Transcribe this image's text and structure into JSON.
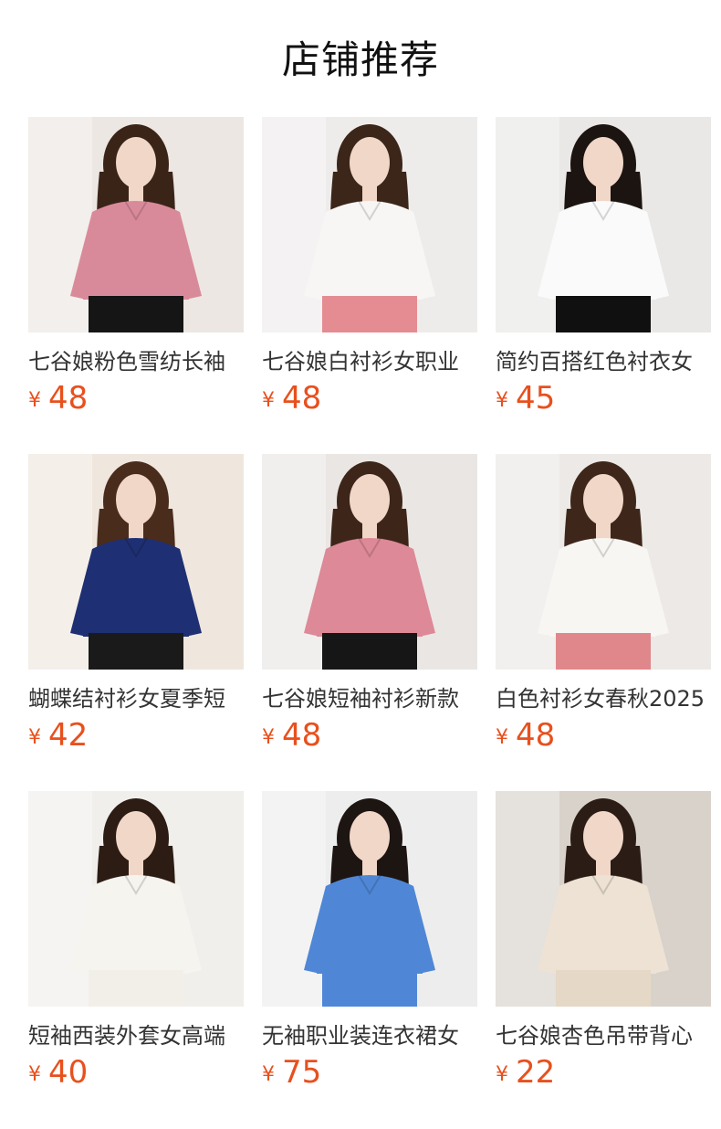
{
  "header": {
    "title": "店铺推荐"
  },
  "colors": {
    "price": "#e8501d"
  },
  "products": [
    {
      "name": "七谷娘粉色雪纺长袖",
      "currency": "¥",
      "price": "48",
      "image": "woman-pink-long-sleeve-blouse",
      "bg": "#ece7e2",
      "top": "#d98a9a",
      "bottom": "#151515",
      "hair": "#3a2418"
    },
    {
      "name": "七谷娘白衬衫女职业",
      "currency": "¥",
      "price": "48",
      "image": "woman-white-short-sleeve-shirt",
      "bg": "#eeeceb",
      "top": "#f7f6f4",
      "bottom": "#e48c92",
      "hair": "#3b2619"
    },
    {
      "name": "简约百搭红色衬衣女",
      "currency": "¥",
      "price": "45",
      "image": "woman-white-striped-shirt",
      "bg": "#e9e8e7",
      "top": "#fafafa",
      "bottom": "#101010",
      "hair": "#1c1410"
    },
    {
      "name": "蝴蝶结衬衫女夏季短",
      "currency": "¥",
      "price": "42",
      "image": "woman-navy-bow-blouse",
      "bg": "#efe6de",
      "top": "#1e2f73",
      "bottom": "#1a1a1a",
      "hair": "#4a2c1c"
    },
    {
      "name": "七谷娘短袖衬衫新款",
      "currency": "¥",
      "price": "48",
      "image": "woman-pink-ruffle-blouse",
      "bg": "#eae6e3",
      "top": "#dd8997",
      "bottom": "#161616",
      "hair": "#3d2619"
    },
    {
      "name": "白色衬衫女春秋2025",
      "currency": "¥",
      "price": "48",
      "image": "woman-white-tie-neck-blouse",
      "bg": "#ece9e6",
      "top": "#f7f6f3",
      "bottom": "#e0878b",
      "hair": "#3e271a"
    },
    {
      "name": "短袖西装外套女高端",
      "currency": "¥",
      "price": "40",
      "image": "woman-white-suit-jacket",
      "bg": "#f1efec",
      "top": "#f6f4ef",
      "bottom": "#f2efe9",
      "hair": "#2c1c14"
    },
    {
      "name": "无袖职业装连衣裙女",
      "currency": "¥",
      "price": "75",
      "image": "woman-blue-sleeveless-dress",
      "bg": "#ededed",
      "top": "#4f87d6",
      "bottom": "#4f87d6",
      "hair": "#1d1512"
    },
    {
      "name": "七谷娘杏色吊带背心",
      "currency": "¥",
      "price": "22",
      "image": "woman-beige-camisole",
      "bg": "#d8d2cb",
      "top": "#ede2d4",
      "bottom": "#e6d8c6",
      "hair": "#2b1d16"
    }
  ]
}
